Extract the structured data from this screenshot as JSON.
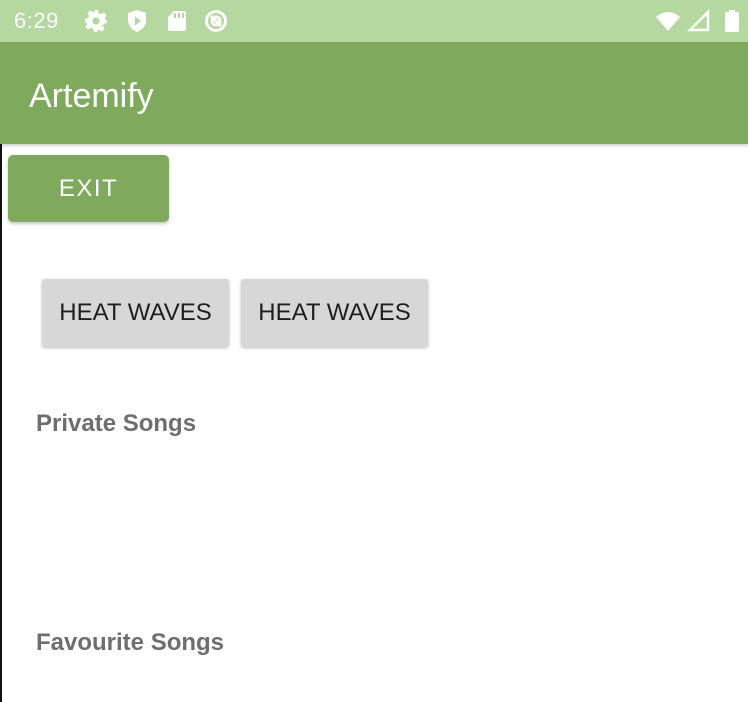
{
  "status_bar": {
    "time": "6:29",
    "background": "#b5d7a0",
    "left_icons": [
      "gear-icon",
      "shield-icon",
      "sd-card-icon",
      "at-sign-icon"
    ],
    "right_icons": [
      "wifi-icon",
      "signal-icon",
      "battery-icon"
    ]
  },
  "app_bar": {
    "title": "Artemify",
    "color": "#7faa5e"
  },
  "exit_button": {
    "label": "EXIT"
  },
  "songs": [
    {
      "label": "HEAT WAVES"
    },
    {
      "label": "HEAT WAVES"
    }
  ],
  "sections": {
    "private": "Private Songs",
    "favourite": "Favourite Songs"
  }
}
